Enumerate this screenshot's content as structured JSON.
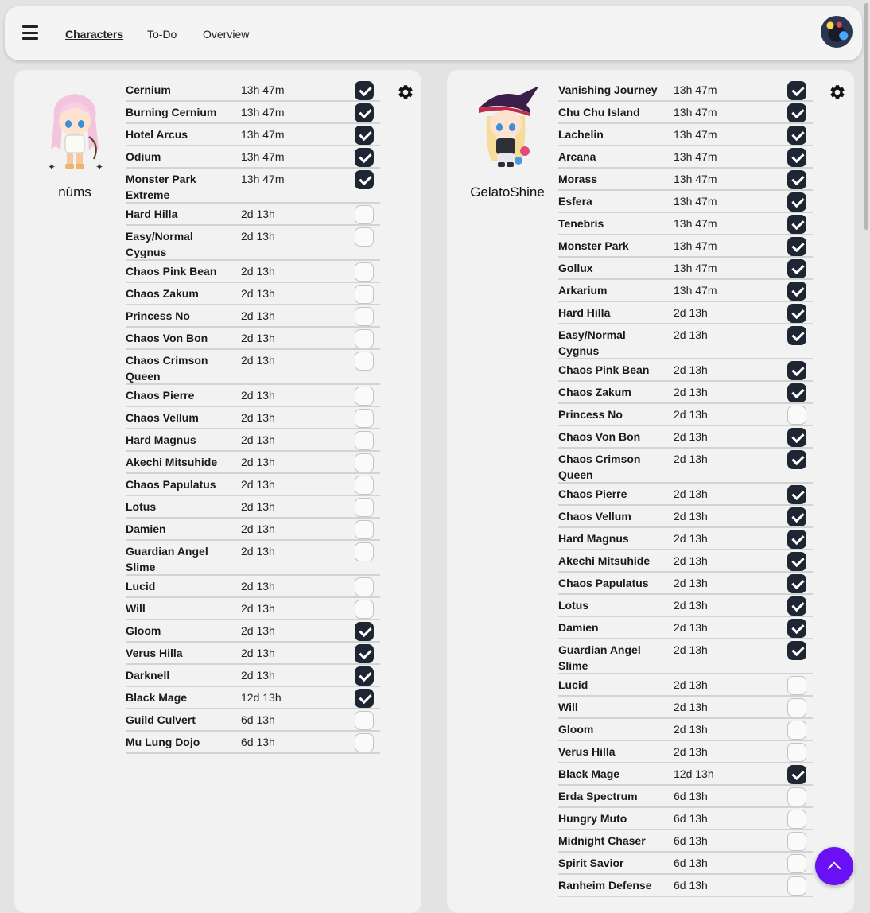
{
  "nav": {
    "links": [
      "Characters",
      "To-Do",
      "Overview"
    ],
    "active": "Characters"
  },
  "colors": {
    "accent": "#6a10f5",
    "checked": "#1e2533",
    "card": "#f2f2f2",
    "background": "#e3e3e3"
  },
  "characters": [
    {
      "name": "nùms",
      "bosses": [
        {
          "name": "Cernium",
          "time": "13h 47m",
          "checked": true
        },
        {
          "name": "Burning Cernium",
          "time": "13h 47m",
          "checked": true
        },
        {
          "name": "Hotel Arcus",
          "time": "13h 47m",
          "checked": true
        },
        {
          "name": "Odium",
          "time": "13h 47m",
          "checked": true
        },
        {
          "name": "Monster Park Extreme",
          "time": "13h 47m",
          "checked": true,
          "wrap": true
        },
        {
          "name": "Hard Hilla",
          "time": "2d 13h",
          "checked": false
        },
        {
          "name": "Easy/Normal Cygnus",
          "time": "2d 13h",
          "checked": false,
          "wrap": true
        },
        {
          "name": "Chaos Pink Bean",
          "time": "2d 13h",
          "checked": false
        },
        {
          "name": "Chaos Zakum",
          "time": "2d 13h",
          "checked": false
        },
        {
          "name": "Princess No",
          "time": "2d 13h",
          "checked": false
        },
        {
          "name": "Chaos Von Bon",
          "time": "2d 13h",
          "checked": false
        },
        {
          "name": "Chaos Crimson Queen",
          "time": "2d 13h",
          "checked": false,
          "wrap": true
        },
        {
          "name": "Chaos Pierre",
          "time": "2d 13h",
          "checked": false
        },
        {
          "name": "Chaos Vellum",
          "time": "2d 13h",
          "checked": false
        },
        {
          "name": "Hard Magnus",
          "time": "2d 13h",
          "checked": false
        },
        {
          "name": "Akechi Mitsuhide",
          "time": "2d 13h",
          "checked": false
        },
        {
          "name": "Chaos Papulatus",
          "time": "2d 13h",
          "checked": false
        },
        {
          "name": "Lotus",
          "time": "2d 13h",
          "checked": false
        },
        {
          "name": "Damien",
          "time": "2d 13h",
          "checked": false
        },
        {
          "name": "Guardian Angel Slime",
          "time": "2d 13h",
          "checked": false,
          "wrap": true
        },
        {
          "name": "Lucid",
          "time": "2d 13h",
          "checked": false
        },
        {
          "name": "Will",
          "time": "2d 13h",
          "checked": false
        },
        {
          "name": "Gloom",
          "time": "2d 13h",
          "checked": true
        },
        {
          "name": "Verus Hilla",
          "time": "2d 13h",
          "checked": true
        },
        {
          "name": "Darknell",
          "time": "2d 13h",
          "checked": true
        },
        {
          "name": "Black Mage",
          "time": "12d 13h",
          "checked": true
        },
        {
          "name": "Guild Culvert",
          "time": "6d 13h",
          "checked": false
        },
        {
          "name": "Mu Lung Dojo",
          "time": "6d 13h",
          "checked": false
        }
      ]
    },
    {
      "name": "GelatoShine",
      "bosses": [
        {
          "name": "Vanishing Journey",
          "time": "13h 47m",
          "checked": true
        },
        {
          "name": "Chu Chu Island",
          "time": "13h 47m",
          "checked": true
        },
        {
          "name": "Lachelin",
          "time": "13h 47m",
          "checked": true
        },
        {
          "name": "Arcana",
          "time": "13h 47m",
          "checked": true
        },
        {
          "name": "Morass",
          "time": "13h 47m",
          "checked": true
        },
        {
          "name": "Esfera",
          "time": "13h 47m",
          "checked": true
        },
        {
          "name": "Tenebris",
          "time": "13h 47m",
          "checked": true
        },
        {
          "name": "Monster Park",
          "time": "13h 47m",
          "checked": true
        },
        {
          "name": "Gollux",
          "time": "13h 47m",
          "checked": true
        },
        {
          "name": "Arkarium",
          "time": "13h 47m",
          "checked": true
        },
        {
          "name": "Hard Hilla",
          "time": "2d 13h",
          "checked": true
        },
        {
          "name": "Easy/Normal Cygnus",
          "time": "2d 13h",
          "checked": true,
          "wrap": true
        },
        {
          "name": "Chaos Pink Bean",
          "time": "2d 13h",
          "checked": true
        },
        {
          "name": "Chaos Zakum",
          "time": "2d 13h",
          "checked": true
        },
        {
          "name": "Princess No",
          "time": "2d 13h",
          "checked": false
        },
        {
          "name": "Chaos Von Bon",
          "time": "2d 13h",
          "checked": true
        },
        {
          "name": "Chaos Crimson Queen",
          "time": "2d 13h",
          "checked": true,
          "wrap": true
        },
        {
          "name": "Chaos Pierre",
          "time": "2d 13h",
          "checked": true
        },
        {
          "name": "Chaos Vellum",
          "time": "2d 13h",
          "checked": true
        },
        {
          "name": "Hard Magnus",
          "time": "2d 13h",
          "checked": true
        },
        {
          "name": "Akechi Mitsuhide",
          "time": "2d 13h",
          "checked": true
        },
        {
          "name": "Chaos Papulatus",
          "time": "2d 13h",
          "checked": true
        },
        {
          "name": "Lotus",
          "time": "2d 13h",
          "checked": true
        },
        {
          "name": "Damien",
          "time": "2d 13h",
          "checked": true
        },
        {
          "name": "Guardian Angel Slime",
          "time": "2d 13h",
          "checked": true,
          "wrap": true
        },
        {
          "name": "Lucid",
          "time": "2d 13h",
          "checked": false
        },
        {
          "name": "Will",
          "time": "2d 13h",
          "checked": false
        },
        {
          "name": "Gloom",
          "time": "2d 13h",
          "checked": false
        },
        {
          "name": "Verus Hilla",
          "time": "2d 13h",
          "checked": false
        },
        {
          "name": "Black Mage",
          "time": "12d 13h",
          "checked": true
        },
        {
          "name": "Erda Spectrum",
          "time": "6d 13h",
          "checked": false
        },
        {
          "name": "Hungry Muto",
          "time": "6d 13h",
          "checked": false
        },
        {
          "name": "Midnight Chaser",
          "time": "6d 13h",
          "checked": false
        },
        {
          "name": "Spirit Savior",
          "time": "6d 13h",
          "checked": false
        },
        {
          "name": "Ranheim Defense",
          "time": "6d 13h",
          "checked": false
        }
      ]
    }
  ]
}
